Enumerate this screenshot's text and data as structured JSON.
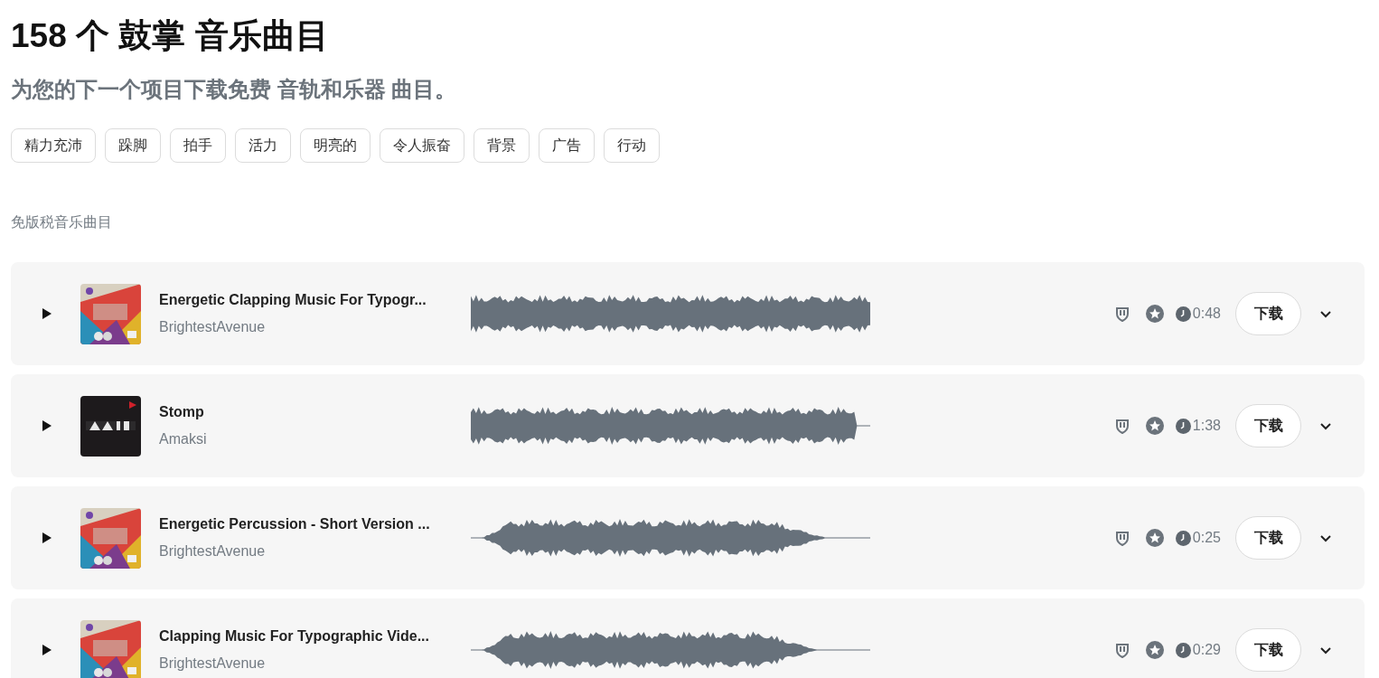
{
  "heading": "158 个 鼓掌 音乐曲目",
  "subheading": "为您的下一个项目下载免费 音轨和乐器 曲目。",
  "tags": [
    "精力充沛",
    "跺脚",
    "拍手",
    "活力",
    "明亮的",
    "令人振奋",
    "背景",
    "广告",
    "行动"
  ],
  "section_label": "免版税音乐曲目",
  "tracks": [
    {
      "title": "Energetic Clapping Music For Typogr...",
      "artist": "BrightestAvenue",
      "duration": "0:48",
      "button": "下载"
    },
    {
      "title": "Stomp",
      "artist": "Amaksi",
      "duration": "1:38",
      "button": "下载"
    },
    {
      "title": "Energetic Percussion - Short Version ...",
      "artist": "BrightestAvenue",
      "duration": "0:25",
      "button": "下载"
    },
    {
      "title": "Clapping Music For Typographic Vide...",
      "artist": "BrightestAvenue",
      "duration": "0:29",
      "button": "下载"
    }
  ]
}
